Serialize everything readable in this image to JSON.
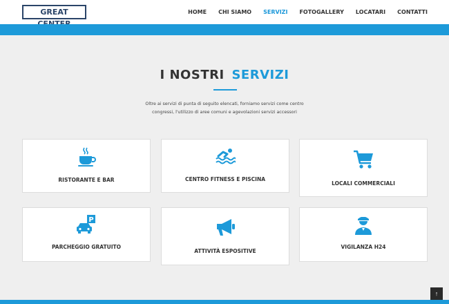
{
  "header": {
    "logo": "GREAT CENTER",
    "nav": [
      {
        "label": "HOME",
        "active": false
      },
      {
        "label": "CHI SIAMO",
        "active": false
      },
      {
        "label": "SERVIZI",
        "active": true
      },
      {
        "label": "FOTOGALLERY",
        "active": false
      },
      {
        "label": "LOCATARI",
        "active": false
      },
      {
        "label": "CONTATTI",
        "active": false
      }
    ]
  },
  "section": {
    "title_main": "I NOSTRI",
    "title_accent": "SERVIZI",
    "intro_line1": "Oltre ai servizi di punta di seguito elencati, forniamo servizi come centro",
    "intro_line2": "congressi, l'utilizzo di aree comuni e agevolazioni servizi accessori"
  },
  "services": [
    {
      "label": "RISTORANTE E BAR",
      "icon": "coffee-cup-icon"
    },
    {
      "label": "CENTRO FITNESS E PISCINA",
      "icon": "swimmer-icon"
    },
    {
      "label": "LOCALI COMMERCIALI",
      "icon": "shopping-cart-icon"
    },
    {
      "label": "PARCHEGGIO GRATUITO",
      "icon": "parking-car-icon"
    },
    {
      "label": "ATTIVITÀ ESPOSITIVE",
      "icon": "megaphone-icon"
    },
    {
      "label": "VIGILANZA H24",
      "icon": "security-guard-icon"
    }
  ],
  "scroll_top_glyph": "↑",
  "colors": {
    "accent": "#1d9ad9",
    "logo": "#2a4468",
    "text": "#333333",
    "background": "#efefef"
  }
}
